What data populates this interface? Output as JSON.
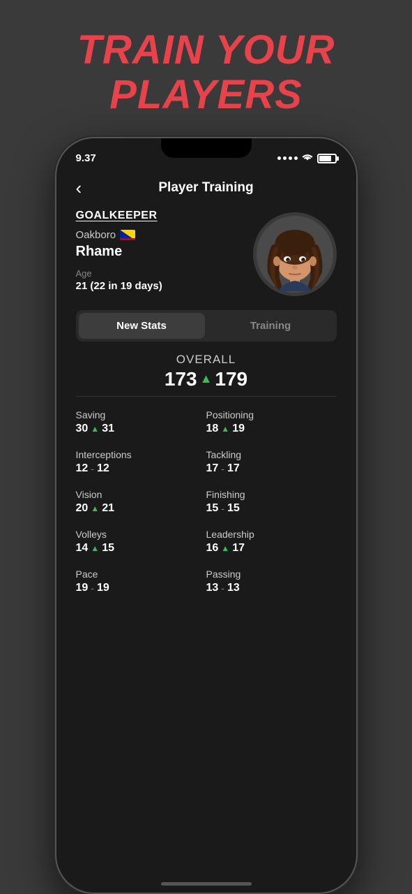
{
  "header": {
    "title": "TRAIN YOUR\nPLAYERS"
  },
  "status_bar": {
    "time": "9.37",
    "wifi": "wifi",
    "battery": "battery"
  },
  "nav": {
    "back_label": "‹",
    "title": "Player Training"
  },
  "player": {
    "position": "GOALKEEPER",
    "club": "Oakboro",
    "name": "Rhame",
    "age_label": "Age",
    "age": "21 (22 in 19 days)"
  },
  "tabs": {
    "active": "New Stats",
    "inactive": "Training"
  },
  "overall": {
    "label": "OVERALL",
    "old": "173",
    "new": "179"
  },
  "stats": [
    {
      "name": "Saving",
      "old": "30",
      "arrow": true,
      "new": "31",
      "col": "left"
    },
    {
      "name": "Positioning",
      "old": "18",
      "arrow": true,
      "new": "19",
      "col": "right"
    },
    {
      "name": "Interceptions",
      "old": "12",
      "arrow": false,
      "new": "12",
      "col": "left"
    },
    {
      "name": "Tackling",
      "old": "17",
      "arrow": false,
      "new": "17",
      "col": "right"
    },
    {
      "name": "Vision",
      "old": "20",
      "arrow": true,
      "new": "21",
      "col": "left"
    },
    {
      "name": "Finishing",
      "old": "15",
      "arrow": false,
      "new": "15",
      "col": "right"
    },
    {
      "name": "Volleys",
      "old": "14",
      "arrow": true,
      "new": "15",
      "col": "left"
    },
    {
      "name": "Leadership",
      "old": "16",
      "arrow": true,
      "new": "17",
      "col": "right"
    },
    {
      "name": "Pace",
      "old": "19",
      "arrow": false,
      "new": "19",
      "col": "left"
    },
    {
      "name": "Passing",
      "old": "13",
      "arrow": false,
      "new": "13",
      "col": "right"
    }
  ]
}
